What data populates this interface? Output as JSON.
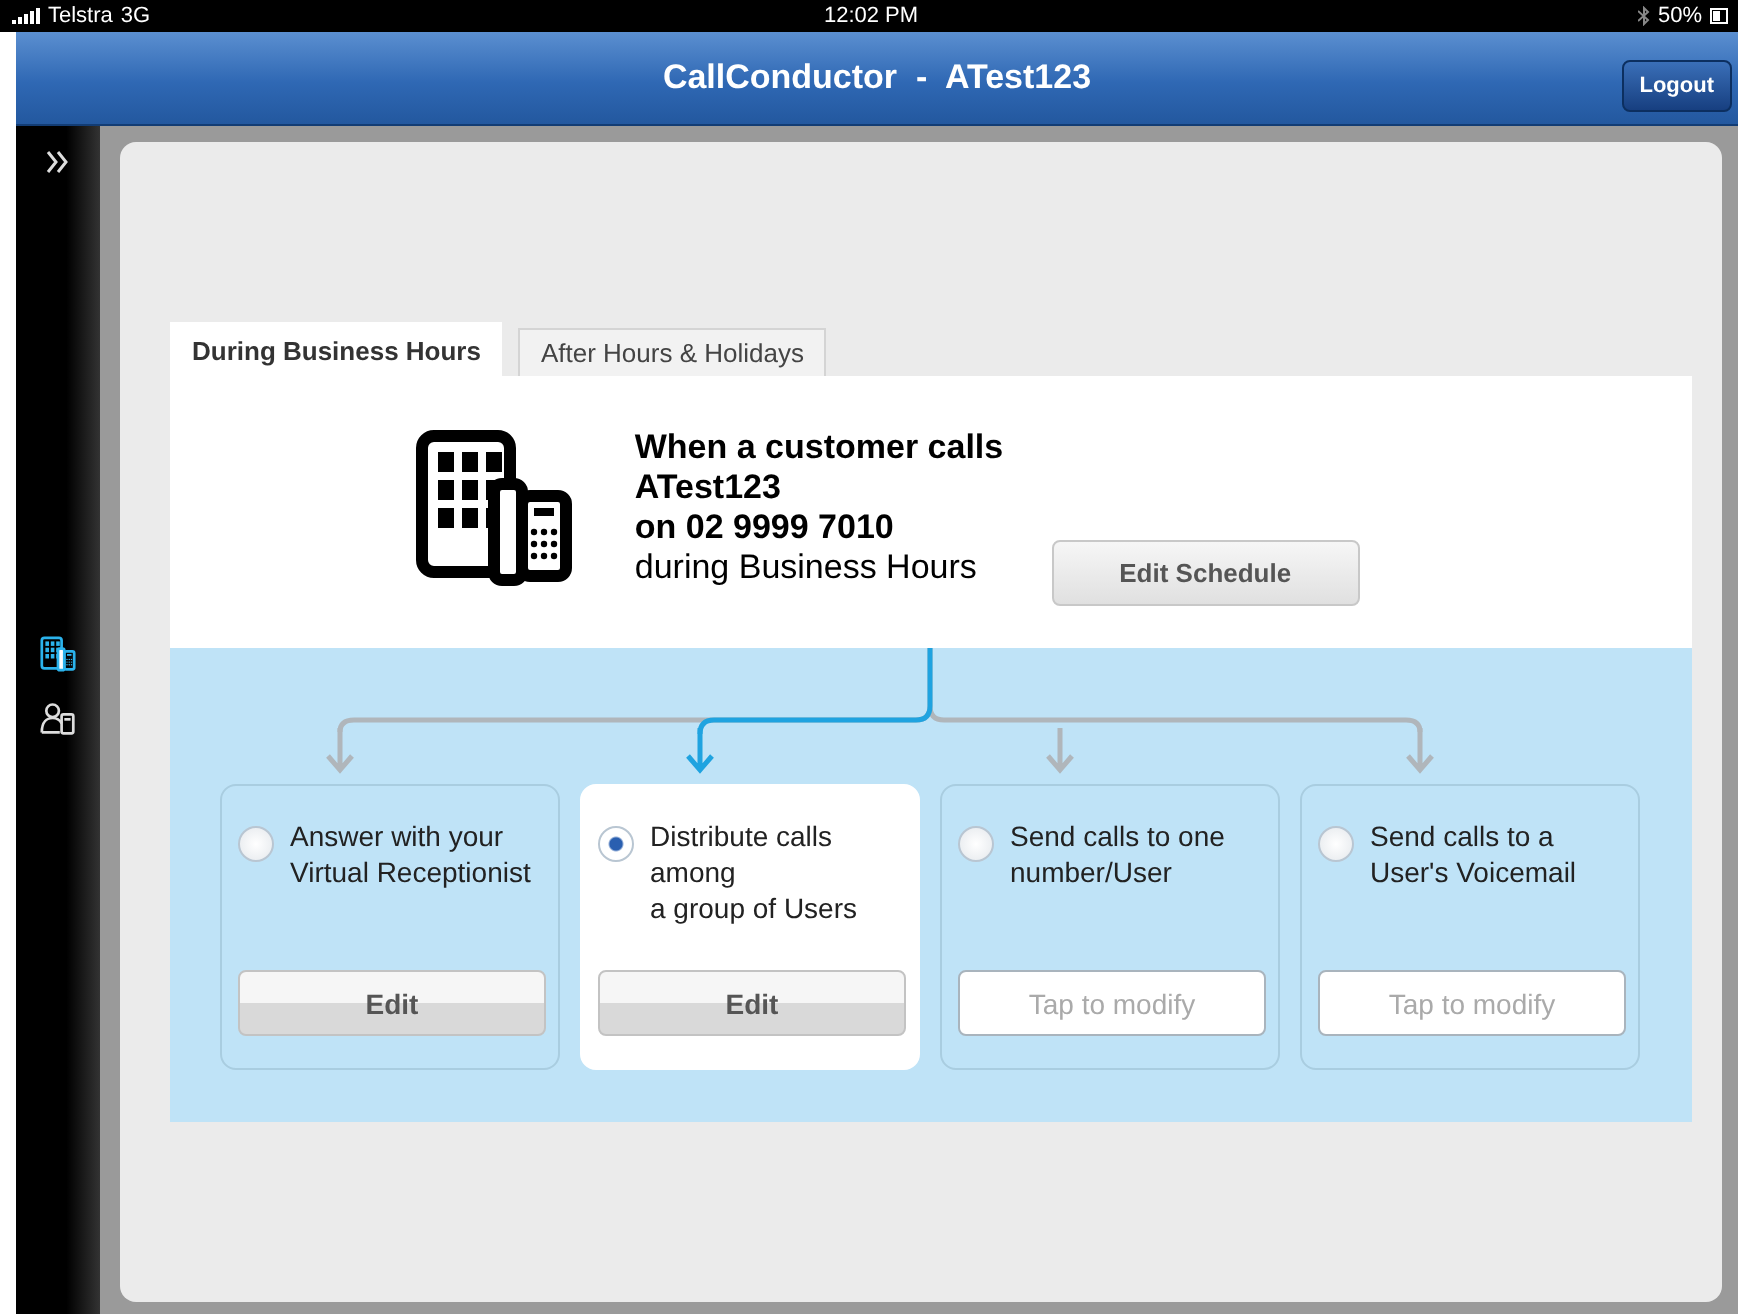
{
  "status_bar": {
    "carrier": "Telstra",
    "network": "3G",
    "time": "12:02 PM",
    "battery": "50%"
  },
  "nav_bar": {
    "title": "CallConductor  -  ATest123",
    "logout": "Logout"
  },
  "sidebar": {
    "items": [
      {
        "kind": "building",
        "selected": true
      },
      {
        "kind": "person",
        "selected": false
      }
    ]
  },
  "tabs": [
    {
      "label": "During Business Hours",
      "selected": true
    },
    {
      "label": "After Hours & Holidays",
      "selected": false
    }
  ],
  "summary": {
    "lines": [
      "When a customer calls",
      "ATest123",
      "on 02 9999 7010"
    ],
    "period": "during Business Hours",
    "edit_schedule": "Edit Schedule"
  },
  "options": [
    {
      "label": "Answer with your\nVirtual Receptionist",
      "selected": false,
      "action": {
        "kind": "edit",
        "label": "Edit"
      }
    },
    {
      "label": "Distribute calls\namong\na group of Users",
      "selected": true,
      "action": {
        "kind": "edit",
        "label": "Edit"
      }
    },
    {
      "label": "Send calls to one\nnumber/User",
      "selected": false,
      "action": {
        "kind": "modify",
        "label": "Tap to modify"
      }
    },
    {
      "label": "Send calls to a\nUser's Voicemail",
      "selected": false,
      "action": {
        "kind": "modify",
        "label": "Tap to modify"
      }
    }
  ]
}
